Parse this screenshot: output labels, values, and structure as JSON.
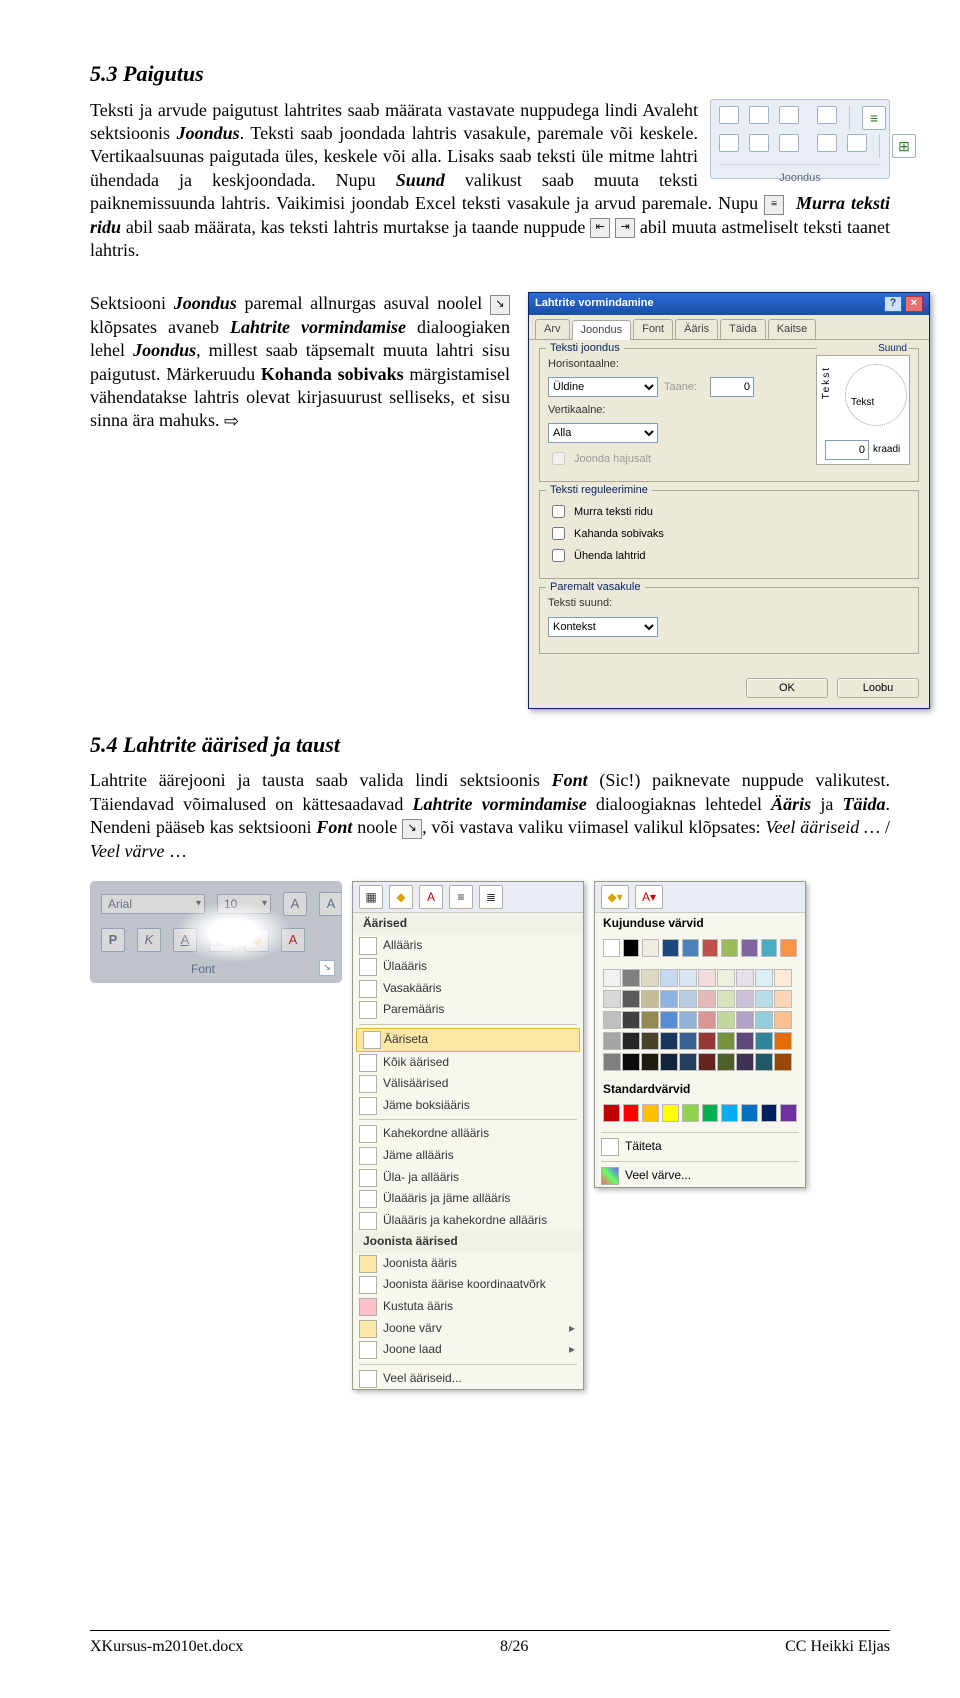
{
  "h53": "5.3  Paigutus",
  "p53a": "Teksti ja arvude paigutust lahtrites saab määrata vastavate nuppudega lindi Avaleht sektsioonis ",
  "p53b": ". Teksti saab joondada lahtris vasakule, paremale või keskele. Vertikaalsuunas paigutada üles, keskele või alla. Lisaks saab teksti üle mitme lahtri ühendada ja keskjoondada. Nupu ",
  "p53c": " valikust saab muuta teksti paiknemissuunda lahtris. Vaikimisi joondab Excel teksti vasakule ja arvud paremale. Nupu ",
  "p53d": " abil saab määrata, kas teksti lahtris murtakse ja taande nuppude ",
  "p53e": " abil muuta astmeliselt teksti taanet lahtris.",
  "joondus": "Joondus",
  "suund_lbl": "Suund",
  "murra": "Murra teksti ridu",
  "p53f": "Sektsiooni ",
  "p53g": " paremal allnurgas asuval noolel ",
  "p53h": " klõpsates avaneb ",
  "p53i": " dialoogiaken lehel ",
  "p53j": ", millest saab täpsemalt muuta lahtri sisu paigutust. Märkeruudu ",
  "p53k": " märgistamisel vähendatakse lahtris olevat kirjasuurust selliseks, et sisu sinna ära mahuks. ",
  "lahtrite_vorm": "Lahtrite vormindamise",
  "lahtrite_vorm_title": "Lahtrite vormindamine",
  "kohanda": "Kohanda sobivaks",
  "right_arrow": "⇨",
  "dlg": {
    "tabs": [
      "Arv",
      "Joondus",
      "Font",
      "Ääris",
      "Täida",
      "Kaitse"
    ],
    "active_tab": 1,
    "grp_tj": "Teksti joondus",
    "lbl_horis": "Horisontaalne:",
    "val_horis": "Üldine",
    "lbl_taane": "Taane:",
    "val_taane": "0",
    "lbl_vert": "Vertikaalne:",
    "val_vert": "Alla",
    "lbl_hajus": "Joonda hajusalt",
    "grp_reg": "Teksti reguleerimine",
    "chk_murra": "Murra teksti ridu",
    "chk_koh": "Kahanda sobivaks",
    "chk_uh": "Ühenda lahtrid",
    "grp_par": "Paremalt vasakule",
    "lbl_suund": "Teksti suund:",
    "val_suund": "Kontekst",
    "grp_suund": "Suund",
    "suund_tekst_v": "Tekst",
    "suund_tekst_h": "Tekst",
    "val_kraadi": "0",
    "lbl_kraadi": "kraadi",
    "btn_ok": "OK",
    "btn_loobu": "Loobu"
  },
  "h54": "5.4  Lahtrite äärised ja taust",
  "p54a": "Lahtrite äärejooni ja tausta saab valida lindi sektsioonis ",
  "p54b": " (Sic!) paiknevate nuppude valikutest. Täiendavad võimalused on kättesaadavad ",
  "p54c": " dialoogiaknas lehtedel ",
  "p54d": " ja ",
  "p54e": ". Nendeni pääseb kas sektsiooni ",
  "p54f": " noole ",
  "p54g": ", või vastava valiku viimasel valikul klõpsates: ",
  "font": "Font",
  "aaris": "Ääris",
  "taida": "Täida",
  "veel_aariseid": "Veel ääriseid …",
  "veel_varve": "Veel värve",
  "slash": " / ",
  "fontbox": {
    "font_name": "Arial",
    "font_size": "10",
    "P": "P",
    "K": "K",
    "A": "A",
    "label": "Font"
  },
  "menu": {
    "hdr": "Äärised",
    "items1": [
      "Allääris",
      "Ülaääris",
      "Vasakääris",
      "Paremääris"
    ],
    "itemhov": "Ääriseta",
    "items2": [
      "Kõik äärised",
      "Välisäärised",
      "Jäme boksiääris"
    ],
    "items3": [
      "Kahekordne allääris",
      "Jäme allääris",
      "Üla- ja allääris",
      "Ülaääris ja jäme allääris",
      "Ülaääris ja kahekordne allääris"
    ],
    "hdr2": "Joonista äärised",
    "items4": [
      "Joonista ääris",
      "Joonista äärise koordinaatvõrk",
      "Kustuta ääris",
      "Joone värv",
      "Joone laad"
    ],
    "last": "Veel ääriseid..."
  },
  "colors": {
    "hdr1": "Kujunduse värvid",
    "row_theme": [
      "#ffffff",
      "#000000",
      "#eeece1",
      "#1f497d",
      "#4f81bd",
      "#c0504d",
      "#9bbb59",
      "#8064a2",
      "#4bacc6",
      "#f79646"
    ],
    "shades": [
      [
        "#f2f2f2",
        "#7f7f7f",
        "#ddd9c3",
        "#c6d9f0",
        "#dbe5f1",
        "#f2dcdb",
        "#ebf1dd",
        "#e5e0ec",
        "#dbeef3",
        "#fdeada"
      ],
      [
        "#d8d8d8",
        "#595959",
        "#c4bd97",
        "#8db3e2",
        "#b8cce4",
        "#e5b9b7",
        "#d7e3bc",
        "#ccc1d9",
        "#b7dde8",
        "#fbd5b5"
      ],
      [
        "#bfbfbf",
        "#3f3f3f",
        "#938953",
        "#548dd4",
        "#95b3d7",
        "#d99694",
        "#c3d69b",
        "#b2a2c7",
        "#92cddc",
        "#fac08f"
      ],
      [
        "#a5a5a5",
        "#262626",
        "#494429",
        "#17365d",
        "#366092",
        "#953734",
        "#76923c",
        "#5f497a",
        "#31859b",
        "#e36c09"
      ],
      [
        "#7f7f7f",
        "#0c0c0c",
        "#1d1b10",
        "#0f243e",
        "#244061",
        "#632423",
        "#4f6128",
        "#3f3151",
        "#205867",
        "#974806"
      ]
    ],
    "hdr2": "Standardvärvid",
    "row_std": [
      "#c00000",
      "#ff0000",
      "#ffc000",
      "#ffff00",
      "#92d050",
      "#00b050",
      "#00b0f0",
      "#0070c0",
      "#002060",
      "#7030a0"
    ],
    "nofill": "Täiteta",
    "more": "Veel värve..."
  },
  "footer": {
    "left": "XKursus-m2010et.docx",
    "mid": "8/26",
    "right": "CC Heikki Eljas"
  }
}
